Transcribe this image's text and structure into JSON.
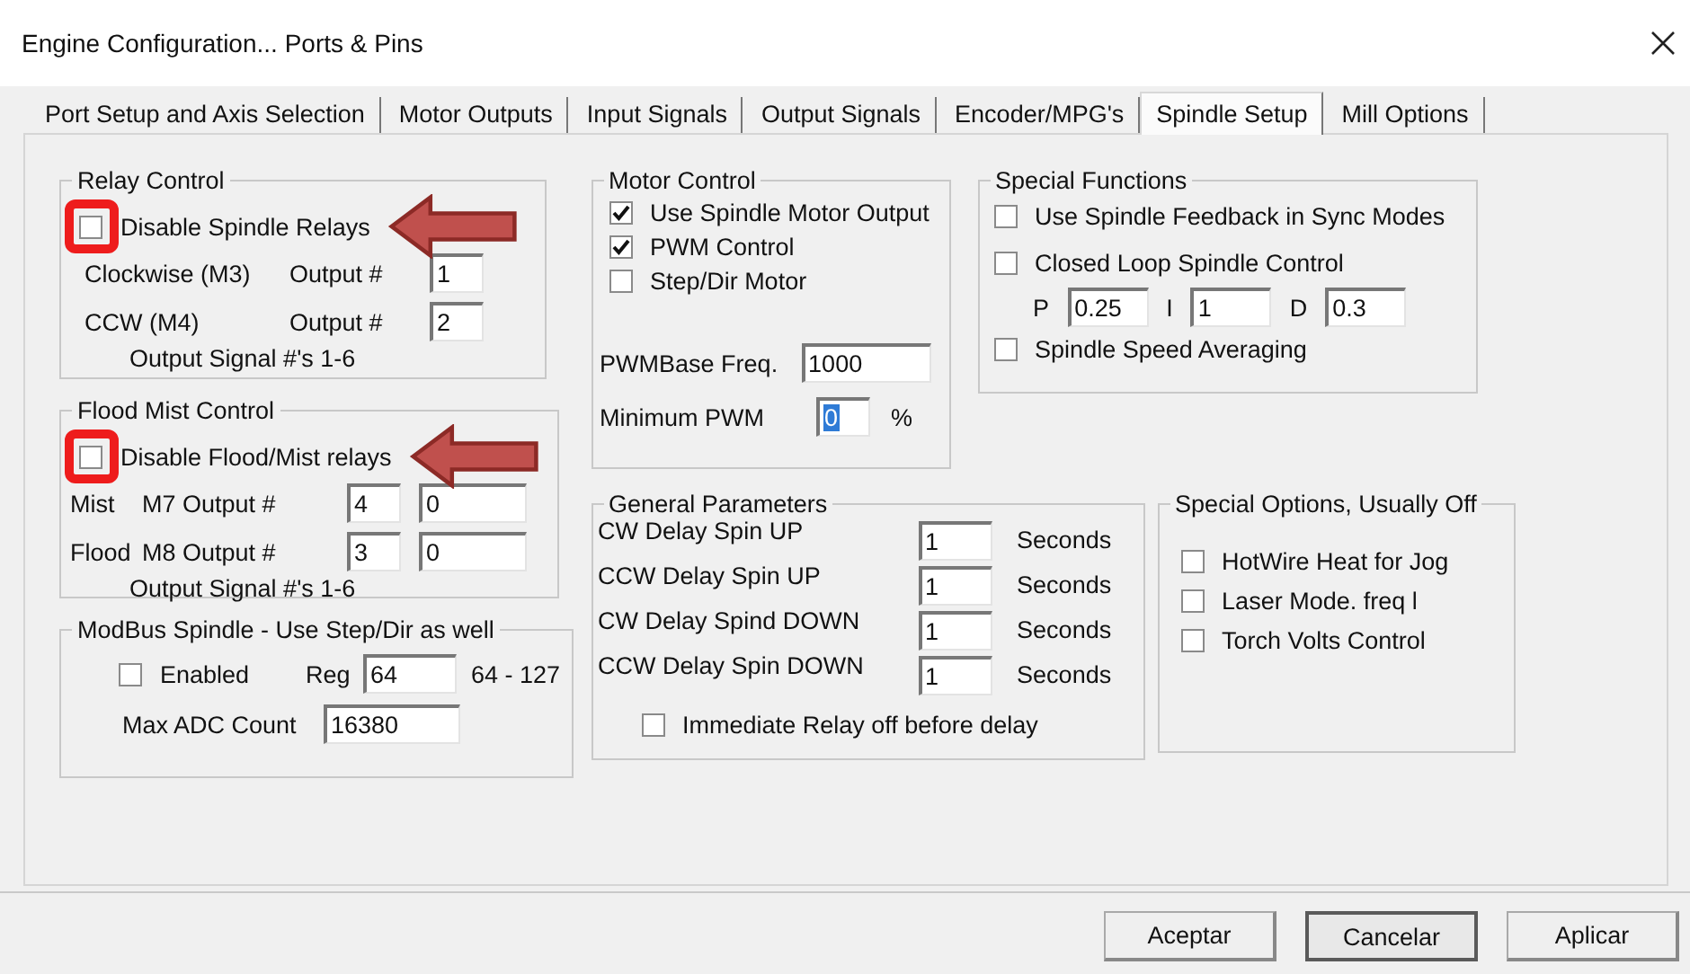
{
  "window": {
    "title": "Engine Configuration... Ports & Pins"
  },
  "tabs": [
    {
      "label": "Port Setup and Axis Selection",
      "selected": false
    },
    {
      "label": "Motor Outputs",
      "selected": false
    },
    {
      "label": "Input Signals",
      "selected": false
    },
    {
      "label": "Output Signals",
      "selected": false
    },
    {
      "label": "Encoder/MPG's",
      "selected": false
    },
    {
      "label": "Spindle Setup",
      "selected": true
    },
    {
      "label": "Mill Options",
      "selected": false
    }
  ],
  "relay_control": {
    "title": "Relay Control",
    "disable": {
      "label": "Disable Spindle Relays",
      "checked": false,
      "annotated": true
    },
    "outputs": [
      {
        "label": "Clockwise (M3)",
        "output_label": "Output #",
        "value": "1"
      },
      {
        "label": "CCW (M4)",
        "output_label": "Output #",
        "value": "2"
      }
    ],
    "note": "Output Signal #'s 1-6"
  },
  "flood_mist_control": {
    "title": "Flood Mist Control",
    "disable": {
      "label": "Disable Flood/Mist relays",
      "checked": false,
      "annotated": true
    },
    "outputs": [
      {
        "name": "Mist",
        "label": "M7 Output #",
        "value": "4",
        "value_2": "0"
      },
      {
        "name": "Flood",
        "label": "M8 Output #",
        "value": "3",
        "value_2": "0"
      }
    ],
    "note": "Output Signal #'s 1-6"
  },
  "modbus_spindle": {
    "title": "ModBus Spindle - Use Step/Dir as well",
    "enabled": {
      "label": "Enabled",
      "checked": false
    },
    "reg_label": "Reg",
    "reg_value": "64",
    "reg_range": "64 - 127",
    "max_adc_label": "Max ADC Count",
    "max_adc_value": "16380"
  },
  "motor_control": {
    "title": "Motor Control",
    "options": [
      {
        "label": "Use Spindle Motor Output",
        "checked": true
      },
      {
        "label": "PWM Control",
        "checked": true
      },
      {
        "label": "Step/Dir Motor",
        "checked": false
      }
    ],
    "fields": [
      {
        "label": "PWMBase Freq.",
        "value": "1000",
        "highlighted": false
      },
      {
        "label": "Minimum PWM",
        "value": "0",
        "highlighted": true,
        "unit": "%"
      }
    ]
  },
  "special_functions": {
    "title": "Special Functions",
    "options": [
      {
        "label": "Use Spindle Feedback in Sync Modes",
        "checked": false
      },
      {
        "label": "Closed Loop Spindle Control",
        "checked": false
      }
    ],
    "pid": [
      {
        "label": "P",
        "value": "0.25"
      },
      {
        "label": "I",
        "value": "1"
      },
      {
        "label": "D",
        "value": "0.3"
      }
    ],
    "averaging": {
      "label": "Spindle Speed Averaging",
      "checked": false
    }
  },
  "general_parameters": {
    "title": "General Parameters",
    "delays": [
      {
        "label": "CW Delay Spin UP",
        "value": "1",
        "unit": "Seconds"
      },
      {
        "label": "CCW Delay Spin UP",
        "value": "1",
        "unit": "Seconds"
      },
      {
        "label": "CW Delay Spind DOWN",
        "value": "1",
        "unit": "Seconds"
      },
      {
        "label": "CCW Delay Spin DOWN",
        "value": "1",
        "unit": "Seconds"
      }
    ],
    "immediate_relay": {
      "label": "Immediate Relay off before delay",
      "checked": false
    }
  },
  "special_options": {
    "title": "Special Options, Usually Off",
    "options": [
      {
        "label": "HotWire Heat for Jog",
        "checked": false
      },
      {
        "label": "Laser Mode. freq l",
        "checked": false
      },
      {
        "label": "Torch Volts Control",
        "checked": false
      }
    ]
  },
  "buttons": [
    {
      "label": "Aceptar",
      "default": false
    },
    {
      "label": "Cancelar",
      "default": true
    },
    {
      "label": "Aplicar",
      "default": false
    }
  ]
}
